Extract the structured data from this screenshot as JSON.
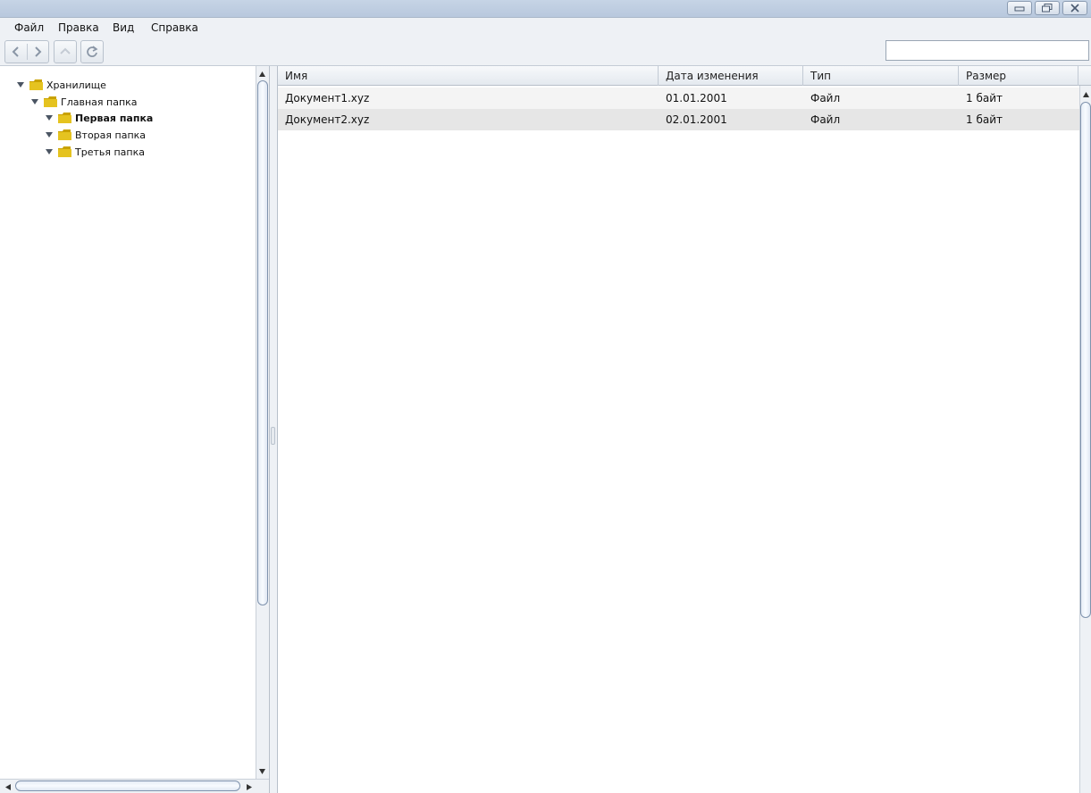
{
  "window": {
    "controls": {
      "minimize": "minimize-icon",
      "restore": "restore-icon",
      "close": "close-icon"
    }
  },
  "menu": {
    "items": [
      "Файл",
      "Правка",
      "Вид",
      "Справка"
    ]
  },
  "toolbar": {
    "icons": [
      "back-icon",
      "forward-icon",
      "up-icon",
      "refresh-icon"
    ],
    "search": {
      "value": "",
      "placeholder": ""
    }
  },
  "tree": {
    "root": "Хранилище",
    "main_folder": "Главная папка",
    "children": [
      "Первая папка",
      "Вторая папка",
      "Третья папка"
    ],
    "selected": "Первая папка",
    "folder_color": "#d9b400"
  },
  "table": {
    "columns": [
      "Имя",
      "Дата изменения",
      "Тип",
      "Размер"
    ],
    "rows": [
      {
        "name": "Документ1.xyz",
        "date": "01.01.2001",
        "type": "Файл",
        "size": "1 байт"
      },
      {
        "name": "Документ2.xyz",
        "date": "02.01.2001",
        "type": "Файл",
        "size": "1 байт"
      }
    ]
  },
  "colors": {
    "accent": "#7f93ad",
    "background": "#eef1f5"
  }
}
